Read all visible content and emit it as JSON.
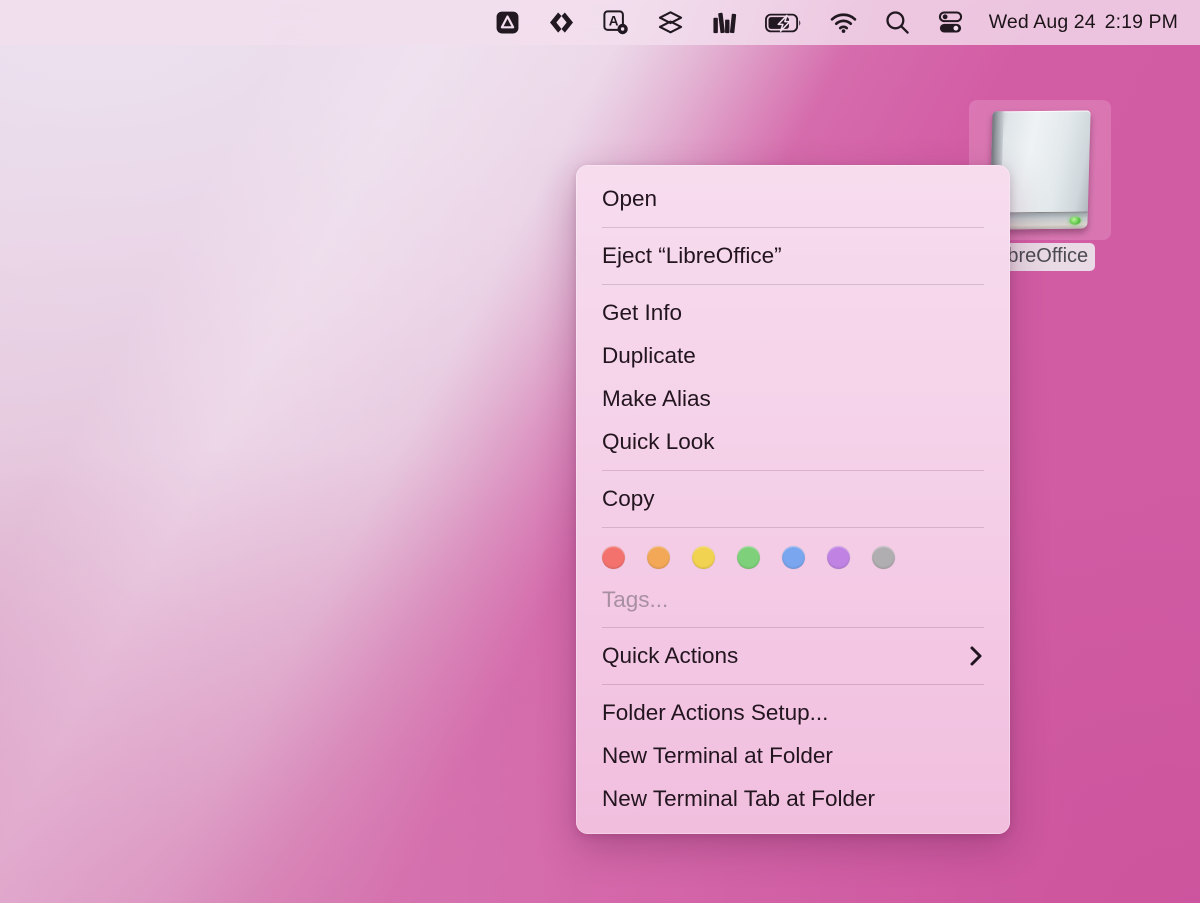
{
  "menubar": {
    "icons": [
      {
        "name": "affinity-icon",
        "label": "Affinity"
      },
      {
        "name": "code-chevrons-icon",
        "label": "Code"
      },
      {
        "name": "text-replacement-icon",
        "label": "Text"
      },
      {
        "name": "layers-icon",
        "label": "Layers"
      },
      {
        "name": "stats-bars-icon",
        "label": "Stats"
      },
      {
        "name": "battery-charging-icon",
        "label": "Battery"
      },
      {
        "name": "wifi-icon",
        "label": "Wi-Fi"
      },
      {
        "name": "spotlight-search-icon",
        "label": "Spotlight"
      },
      {
        "name": "control-center-icon",
        "label": "Control Center"
      }
    ],
    "date": "Wed Aug 24",
    "time": "2:19 PM"
  },
  "desktop": {
    "drive": {
      "label": "LibreOffice",
      "selected": true
    },
    "wallpaper_colors": {
      "pale_lavender": "#e9d7e6",
      "mid_pink": "#e2bcd6",
      "deep_magenta": "#d35da5",
      "bottom_pink": "#d47fb4"
    }
  },
  "context_menu": {
    "background_top": "#f7dcee",
    "background_bottom": "#f1bede",
    "text_color": "#23151f",
    "groups": [
      {
        "items": [
          {
            "label": "Open",
            "name": "menu-item-open",
            "submenu": false
          }
        ]
      },
      {
        "items": [
          {
            "label": "Eject “LibreOffice”",
            "name": "menu-item-eject",
            "submenu": false
          }
        ]
      },
      {
        "items": [
          {
            "label": "Get Info",
            "name": "menu-item-get-info",
            "submenu": false
          },
          {
            "label": "Duplicate",
            "name": "menu-item-duplicate",
            "submenu": false
          },
          {
            "label": "Make Alias",
            "name": "menu-item-make-alias",
            "submenu": false
          },
          {
            "label": "Quick Look",
            "name": "menu-item-quick-look",
            "submenu": false
          }
        ]
      },
      {
        "items": [
          {
            "label": "Copy",
            "name": "menu-item-copy",
            "submenu": false
          }
        ]
      },
      {
        "type": "tags",
        "tags_placeholder": "Tags...",
        "tag_colors": [
          {
            "name": "tag-red",
            "hex": "#f4726e"
          },
          {
            "name": "tag-orange",
            "hex": "#f3a857"
          },
          {
            "name": "tag-yellow",
            "hex": "#f2d251"
          },
          {
            "name": "tag-green",
            "hex": "#7ed07a"
          },
          {
            "name": "tag-blue",
            "hex": "#7aa6ef"
          },
          {
            "name": "tag-purple",
            "hex": "#c083e4"
          },
          {
            "name": "tag-gray",
            "hex": "#b0aeb0"
          }
        ]
      },
      {
        "items": [
          {
            "label": "Quick Actions",
            "name": "menu-item-quick-actions",
            "submenu": true
          }
        ]
      },
      {
        "items": [
          {
            "label": "Folder Actions Setup...",
            "name": "menu-item-folder-actions-setup",
            "submenu": false
          },
          {
            "label": "New Terminal at Folder",
            "name": "menu-item-new-terminal-at-folder",
            "submenu": false
          },
          {
            "label": "New Terminal Tab at Folder",
            "name": "menu-item-new-terminal-tab-at-folder",
            "submenu": false
          }
        ]
      }
    ]
  }
}
